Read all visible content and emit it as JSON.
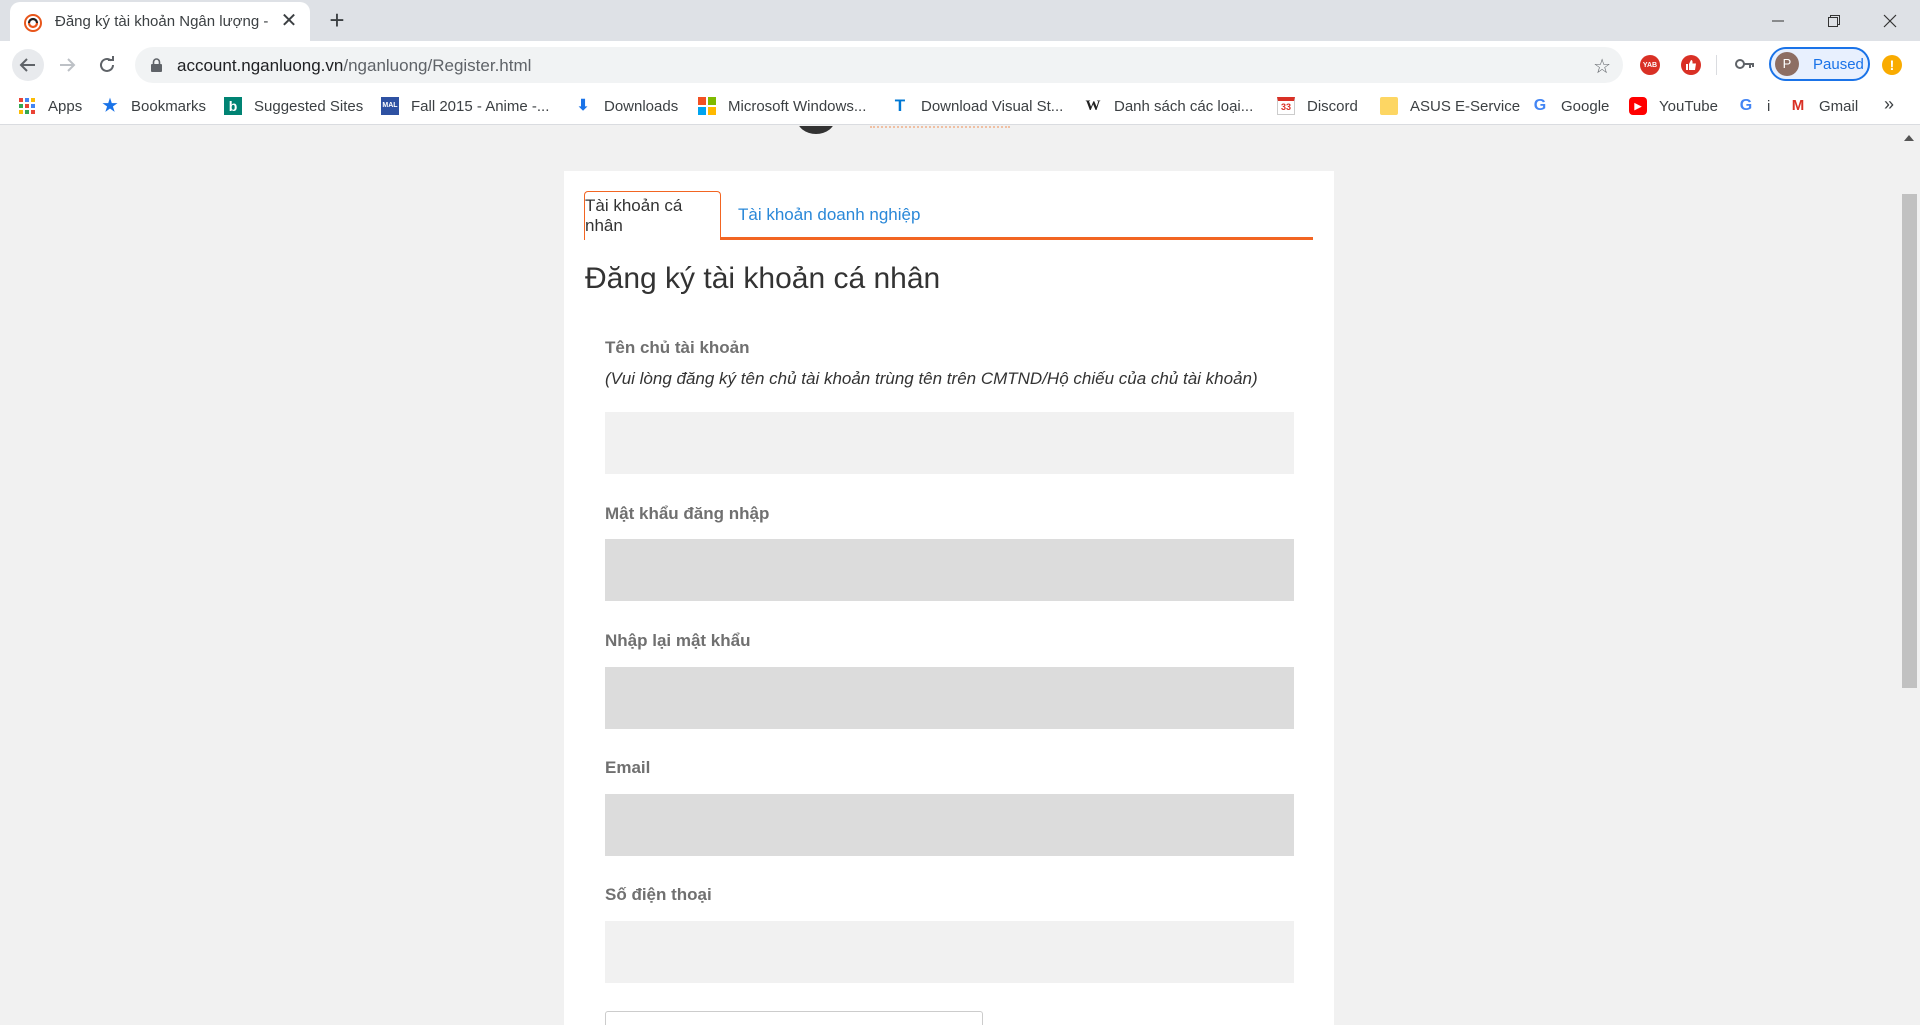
{
  "browser": {
    "tab_title": "Đăng ký tài khoản Ngân lượng -",
    "close_tab": "✕",
    "new_tab": "+",
    "url_domain": "account.nganluong.vn",
    "url_path": "/nganluong/Register.html",
    "profile_initial": "P",
    "profile_status": "Paused",
    "alert_symbol": "!",
    "ext_yab": "YAB",
    "more_bookmarks": "»"
  },
  "bookmarks": [
    {
      "label": "Apps",
      "icon": "apps-grid-icon"
    },
    {
      "label": "Bookmarks",
      "icon": "star-icon"
    },
    {
      "label": "Suggested Sites",
      "icon": "bing-icon"
    },
    {
      "label": "Fall 2015 - Anime -...",
      "icon": "mal-icon"
    },
    {
      "label": "Downloads",
      "icon": "download-icon"
    },
    {
      "label": "Microsoft Windows...",
      "icon": "windows-icon"
    },
    {
      "label": "Download Visual St...",
      "icon": "visual-studio-icon"
    },
    {
      "label": "Danh sách các loại...",
      "icon": "wikipedia-icon"
    },
    {
      "label": "Discord",
      "icon": "calendar-icon"
    },
    {
      "label": "ASUS E-Service",
      "icon": "folder-icon"
    },
    {
      "label": "Google",
      "icon": "google-icon"
    },
    {
      "label": "YouTube",
      "icon": "youtube-icon"
    },
    {
      "label": "i",
      "icon": "google-icon"
    },
    {
      "label": "Gmail",
      "icon": "gmail-icon"
    }
  ],
  "bookmark_glyphs": {
    "star": "★",
    "bing": "b",
    "mal": "MAL",
    "download": "⬇",
    "vs": "T",
    "wiki": "W",
    "cal": "33",
    "google": "G",
    "yt": "▶",
    "gmail": "M"
  },
  "registration": {
    "tab_personal": "Tài khoản cá nhân",
    "tab_business": "Tài khoản doanh nghiệp",
    "title": "Đăng ký tài khoản cá nhân",
    "fields": [
      {
        "label": "Tên chủ tài khoản",
        "value": ""
      },
      {
        "label": "Mật khẩu đăng nhập",
        "value": ""
      },
      {
        "label": "Nhập lại mật khẩu",
        "value": ""
      },
      {
        "label": "Email",
        "value": ""
      },
      {
        "label": "Số điện thoại",
        "value": ""
      }
    ],
    "name_note": "(Vui lòng đăng ký tên chủ tài khoản trùng tên trên CMTND/Hộ chiếu của chủ tài khoản)"
  },
  "colors": {
    "accent": "#f26522",
    "link": "#2a88d8",
    "profile": "#1a73e8"
  }
}
